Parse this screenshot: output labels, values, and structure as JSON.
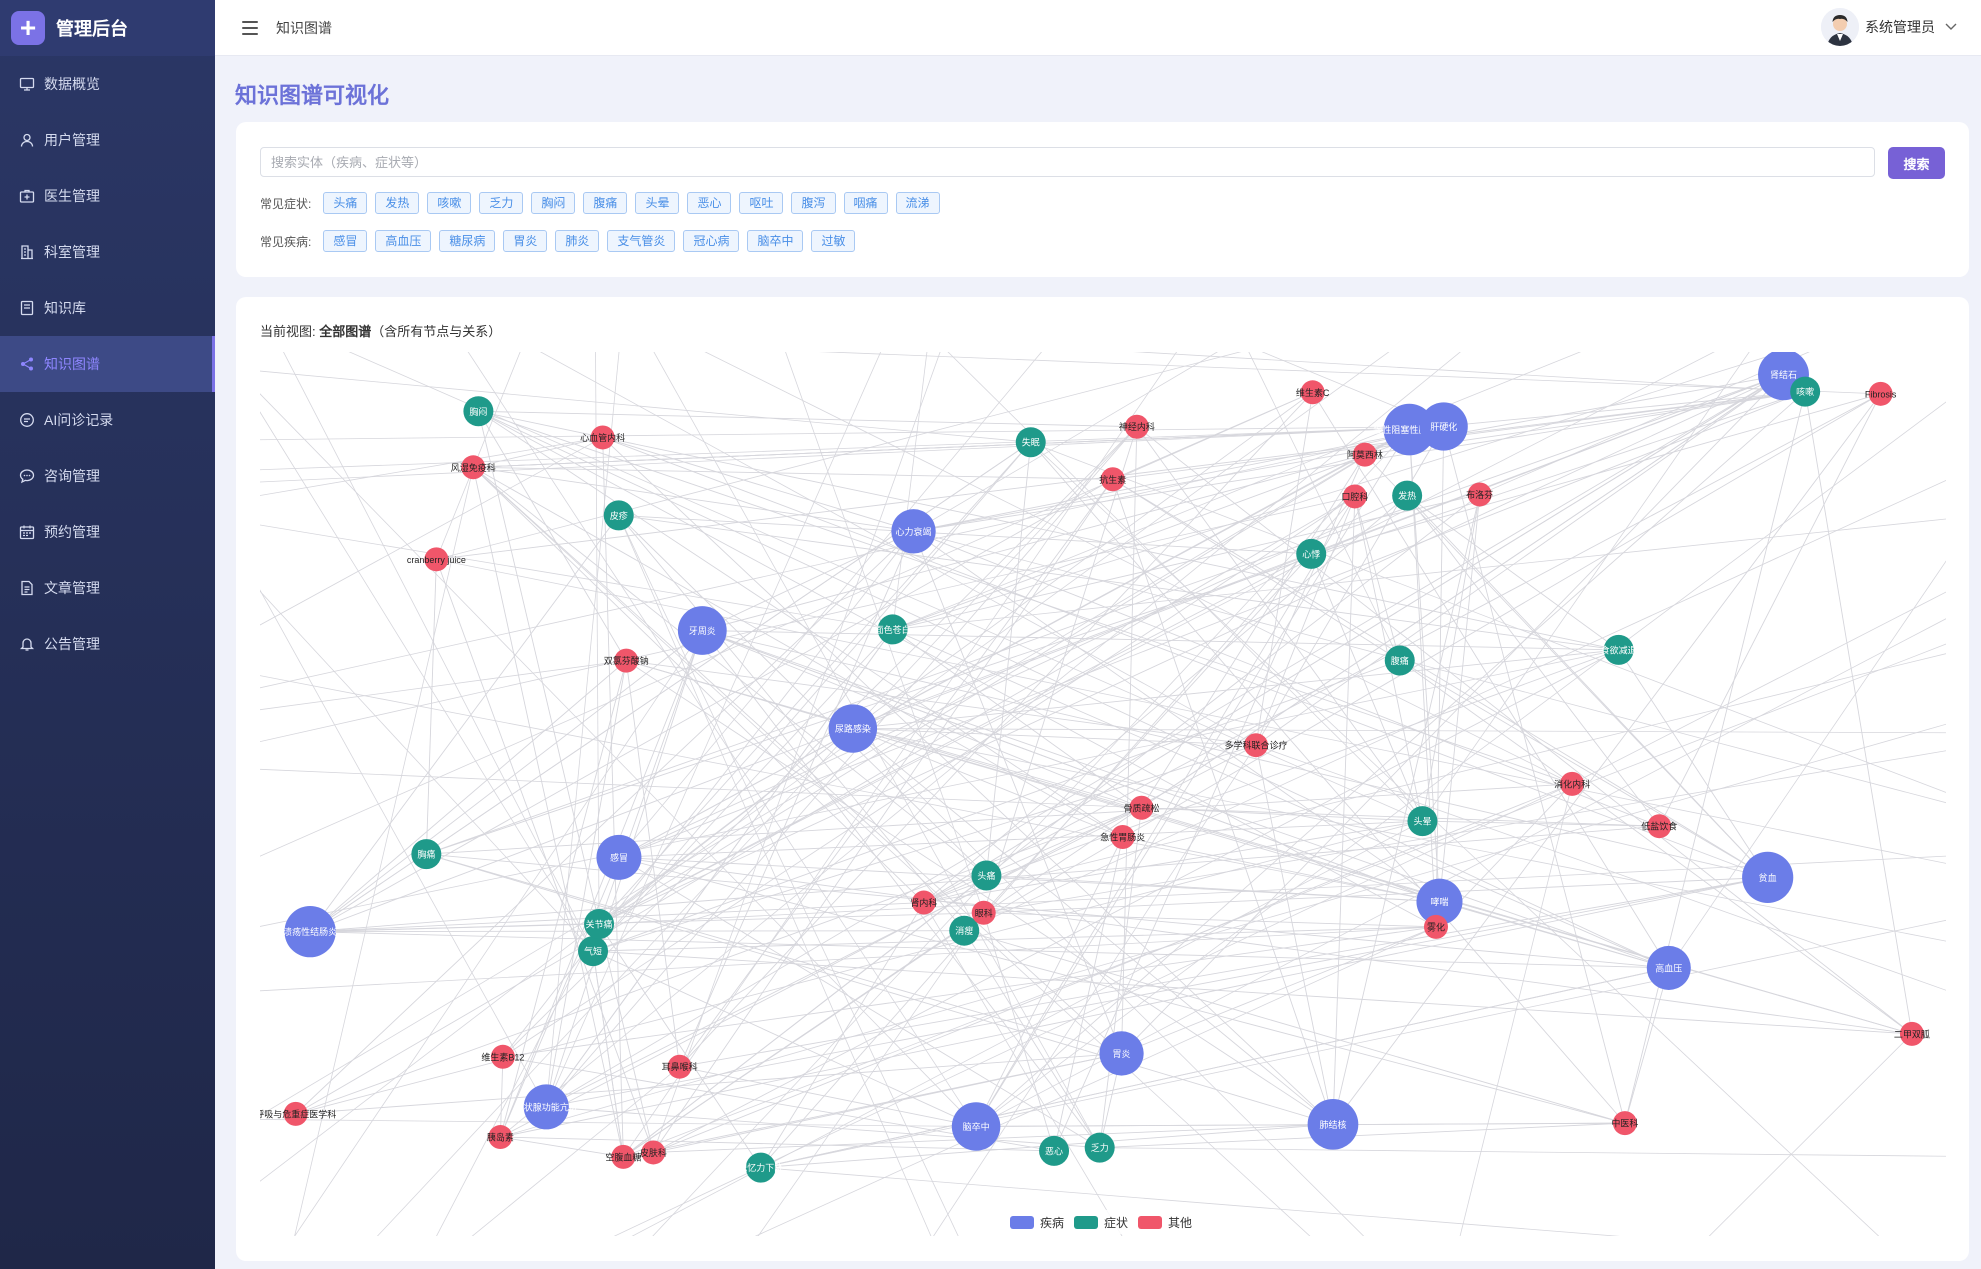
{
  "brand": {
    "title": "管理后台"
  },
  "sidebar": {
    "items": [
      {
        "label": "数据概览",
        "icon": "monitor-icon"
      },
      {
        "label": "用户管理",
        "icon": "user-icon"
      },
      {
        "label": "医生管理",
        "icon": "medical-box-icon"
      },
      {
        "label": "科室管理",
        "icon": "building-icon"
      },
      {
        "label": "知识库",
        "icon": "book-icon"
      },
      {
        "label": "知识图谱",
        "icon": "share-icon",
        "active": true
      },
      {
        "label": "AI问诊记录",
        "icon": "chat-icon"
      },
      {
        "label": "咨询管理",
        "icon": "message-icon"
      },
      {
        "label": "预约管理",
        "icon": "calendar-icon"
      },
      {
        "label": "文章管理",
        "icon": "document-icon"
      },
      {
        "label": "公告管理",
        "icon": "bell-icon"
      }
    ]
  },
  "header": {
    "breadcrumb": "知识图谱",
    "username": "系统管理员"
  },
  "page": {
    "title": "知识图谱可视化"
  },
  "search": {
    "placeholder": "搜索实体（疾病、症状等）",
    "button_label": "搜索",
    "symptoms_label": "常见症状:",
    "symptoms": [
      "头痛",
      "发热",
      "咳嗽",
      "乏力",
      "胸闷",
      "腹痛",
      "头晕",
      "恶心",
      "呕吐",
      "腹泻",
      "咽痛",
      "流涕"
    ],
    "diseases_label": "常见疾病:",
    "diseases": [
      "感冒",
      "高血压",
      "糖尿病",
      "胃炎",
      "肺炎",
      "支气管炎",
      "冠心病",
      "脑卒中",
      "过敏"
    ]
  },
  "graph": {
    "view_prefix": "当前视图:",
    "view_name": "全部图谱",
    "view_suffix": "（含所有节点与关系）",
    "colors": {
      "disease": "#6b7de8",
      "symptom": "#1f9a8a",
      "other": "#f0566a",
      "edge": "#d6d6dc"
    },
    "legend": [
      {
        "label": "疾病",
        "type": "disease"
      },
      {
        "label": "症状",
        "type": "symptom"
      },
      {
        "label": "其他",
        "type": "other"
      }
    ],
    "nodes": [
      {
        "label": "慢性阻塞性肺疾病",
        "type": "disease"
      },
      {
        "label": "急性胃肠炎",
        "type": "other"
      },
      {
        "label": "肺结核",
        "type": "disease"
      },
      {
        "label": "胸痛",
        "type": "symptom"
      },
      {
        "label": "溃疡性结肠炎",
        "type": "disease"
      },
      {
        "label": "尿路感染",
        "type": "disease"
      },
      {
        "label": "头痛",
        "type": "symptom"
      },
      {
        "label": "心血管内科",
        "type": "other"
      },
      {
        "label": "哮喘",
        "type": "disease"
      },
      {
        "label": "空腹血糖",
        "type": "other"
      },
      {
        "label": "cranberry juice",
        "type": "other"
      },
      {
        "label": "肾结石",
        "type": "disease"
      },
      {
        "label": "肝硬化",
        "type": "disease"
      },
      {
        "label": "阿莫西林",
        "type": "other"
      },
      {
        "label": "气短",
        "type": "symptom"
      },
      {
        "label": "关节痛",
        "type": "symptom"
      },
      {
        "label": "呼吸与危重症医学科",
        "type": "other"
      },
      {
        "label": "风湿免疫科",
        "type": "other"
      },
      {
        "label": "消化内科",
        "type": "other"
      },
      {
        "label": "甲状腺功能亢进",
        "type": "disease"
      },
      {
        "label": "维生素C",
        "type": "other"
      },
      {
        "label": "贫血",
        "type": "disease"
      },
      {
        "label": "心力衰竭",
        "type": "disease"
      },
      {
        "label": "腹痛",
        "type": "symptom"
      },
      {
        "label": "咳嗽",
        "type": "symptom"
      },
      {
        "label": "布洛芬",
        "type": "other"
      },
      {
        "label": "乏力",
        "type": "symptom"
      },
      {
        "label": "记忆力下降",
        "type": "symptom"
      },
      {
        "label": "胃炎",
        "type": "disease"
      },
      {
        "label": "头晕",
        "type": "symptom"
      },
      {
        "label": "胰岛素",
        "type": "other"
      },
      {
        "label": "低盐饮食",
        "type": "other"
      },
      {
        "label": "高血压",
        "type": "disease"
      },
      {
        "label": "恶心",
        "type": "symptom"
      },
      {
        "label": "发热",
        "type": "symptom"
      },
      {
        "label": "牙周炎",
        "type": "disease"
      },
      {
        "label": "维生素B12",
        "type": "other"
      },
      {
        "label": "多学科联合诊疗",
        "type": "other"
      },
      {
        "label": "Fibrosis",
        "type": "other"
      },
      {
        "label": "抗生素",
        "type": "other"
      },
      {
        "label": "神经内科",
        "type": "other"
      },
      {
        "label": "骨质疏松",
        "type": "other"
      },
      {
        "label": "二甲双胍",
        "type": "other"
      },
      {
        "label": "双氯芬酸钠",
        "type": "other"
      },
      {
        "label": "感冒",
        "type": "disease"
      },
      {
        "label": "口腔科",
        "type": "other"
      },
      {
        "label": "失眠",
        "type": "symptom"
      },
      {
        "label": "食欲减退",
        "type": "symptom"
      },
      {
        "label": "消瘦",
        "type": "symptom"
      },
      {
        "label": "皮疹",
        "type": "symptom"
      },
      {
        "label": "面色苍白",
        "type": "symptom"
      },
      {
        "label": "雾化",
        "type": "other"
      },
      {
        "label": "眼科",
        "type": "other"
      },
      {
        "label": "肾内科",
        "type": "other"
      },
      {
        "label": "心悸",
        "type": "symptom"
      },
      {
        "label": "胸闷",
        "type": "symptom"
      },
      {
        "label": "脑卒中",
        "type": "disease"
      },
      {
        "label": "耳鼻喉科",
        "type": "other"
      },
      {
        "label": "中医科",
        "type": "other"
      },
      {
        "label": "皮肤科",
        "type": "other"
      }
    ]
  }
}
